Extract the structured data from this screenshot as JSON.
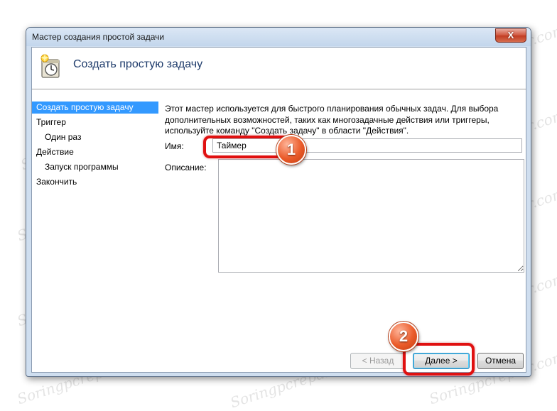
{
  "window": {
    "title": "Мастер создания простой задачи",
    "close_glyph": "X"
  },
  "header": {
    "title": "Создать простую задачу",
    "icon": "task-scheduler-wizard-icon"
  },
  "steps": [
    {
      "label": "Создать простую задачу",
      "active": true
    },
    {
      "label": "Триггер",
      "active": false
    },
    {
      "label": "Один раз",
      "active": false
    },
    {
      "label": "Действие",
      "active": false
    },
    {
      "label": "Запуск программы",
      "active": false
    },
    {
      "label": "Закончить",
      "active": false
    }
  ],
  "description": {
    "line1": "Этот мастер используется для быстрого планирования обычных задач.  Для выбора",
    "line2": "дополнительных возможностей, таких как многозадачные действия или триггеры,",
    "line3": "используйте команду \"Создать задачу\" в области \"Действия\"."
  },
  "form": {
    "name_label": "Имя:",
    "name_value": "Таймер",
    "desc_label": "Описание:",
    "desc_value": ""
  },
  "buttons": {
    "back": "< Назад",
    "next": "Далее >",
    "cancel": "Отмена"
  },
  "annotations": {
    "badge1": "1",
    "badge2": "2"
  },
  "watermark": "Soringpcrepair.com",
  "colors": {
    "highlight": "#e01010",
    "badge": "#ea5b2a",
    "selection": "#3399ff",
    "header_title": "#1e3b6b"
  }
}
